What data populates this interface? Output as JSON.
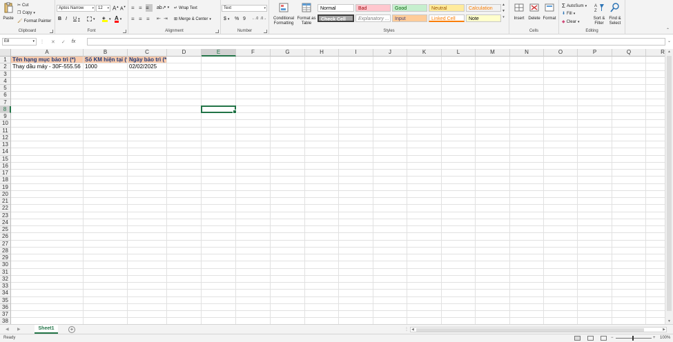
{
  "ribbon": {
    "clipboard": {
      "label": "Clipboard",
      "paste": "Paste",
      "cut": "Cut",
      "copy": "Copy",
      "format_painter": "Format Painter"
    },
    "font": {
      "label": "Font",
      "font_name": "Aptos Narrow",
      "font_size": "12",
      "bold": "B",
      "italic": "I",
      "underline": "U",
      "font_color_letter": "A",
      "highlight_color": "#ffff00",
      "font_color": "#ff0000"
    },
    "alignment": {
      "label": "Alignment",
      "wrap_text": "Wrap Text",
      "merge_center": "Merge & Center"
    },
    "number": {
      "label": "Number",
      "format": "Text",
      "currency": "$",
      "percent": "%",
      "comma": "9"
    },
    "styles": {
      "label": "Styles",
      "conditional_formatting": "Conditional Formatting",
      "format_as_table": "Format as Table",
      "cells": [
        {
          "name": "Normal",
          "bg": "#ffffff",
          "color": "#000000"
        },
        {
          "name": "Bad",
          "bg": "#ffc7ce",
          "color": "#9c0006"
        },
        {
          "name": "Good",
          "bg": "#c6efce",
          "color": "#006100"
        },
        {
          "name": "Neutral",
          "bg": "#ffeb9c",
          "color": "#9c5700"
        },
        {
          "name": "Calculation",
          "bg": "#f2f2f2",
          "color": "#fa7d00"
        },
        {
          "name": "Check Cell",
          "bg": "#a5a5a5",
          "color": "#ffffff"
        },
        {
          "name": "Explanatory ...",
          "bg": "#ffffff",
          "color": "#7f7f7f"
        },
        {
          "name": "Input",
          "bg": "#ffcc99",
          "color": "#3f3f76"
        },
        {
          "name": "Linked Cell",
          "bg": "#ffffff",
          "color": "#fa7d00"
        },
        {
          "name": "Note",
          "bg": "#ffffcc",
          "color": "#000000"
        }
      ]
    },
    "cells": {
      "label": "Cells",
      "insert": "Insert",
      "delete": "Delete",
      "format": "Format"
    },
    "editing": {
      "label": "Editing",
      "autosum": "AutoSum",
      "fill": "Fill",
      "clear": "Clear",
      "sort_filter": "Sort & Filter",
      "find_select": "Find & Select"
    }
  },
  "formula_bar": {
    "name_box": "E8",
    "cancel": "✕",
    "enter": "✓",
    "fx": "fx",
    "content": ""
  },
  "sheet": {
    "columns": [
      "A",
      "B",
      "C",
      "D",
      "E",
      "F",
      "G",
      "H",
      "I",
      "J",
      "K",
      "L",
      "M",
      "N",
      "O",
      "P",
      "Q",
      "R"
    ],
    "rows": [
      "1",
      "2",
      "3",
      "4",
      "5",
      "6",
      "7",
      "8",
      "9",
      "10",
      "11",
      "12",
      "13",
      "14",
      "15",
      "16",
      "17",
      "18",
      "19",
      "20",
      "21",
      "22",
      "23",
      "24",
      "25",
      "26",
      "27",
      "28",
      "29",
      "30",
      "31",
      "32",
      "33",
      "34",
      "35",
      "36",
      "37",
      "38"
    ],
    "selected_cell": "E8",
    "headers": [
      "Tên hạng mục bảo trì (*)",
      "Số KM hiện tại (*)",
      "Ngày bảo trì (*)"
    ],
    "data_row": [
      "Thay dầu máy - 30F-555.56",
      "1000",
      "02/02/2025"
    ]
  },
  "tabs": {
    "sheet_name": "Sheet1",
    "add": "+"
  },
  "status": {
    "ready": "Ready",
    "zoom": "100%"
  },
  "colors": {
    "accent": "#217346",
    "header_fill": "#f8cbad"
  }
}
